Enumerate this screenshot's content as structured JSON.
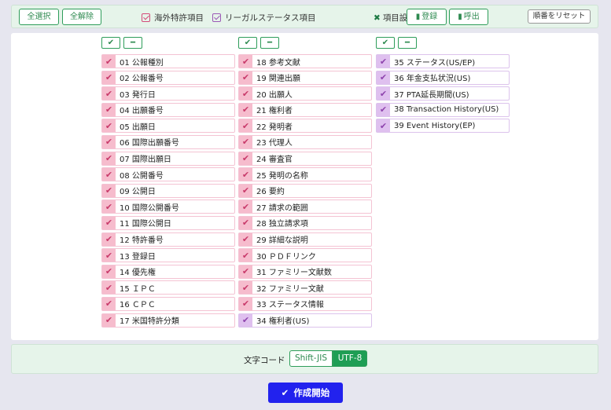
{
  "toolbar": {
    "select_all": "全選択",
    "deselect_all": "全解除",
    "foreign_patent": "海外特許項目",
    "legal_status": "リーガルステータス項目",
    "item_setting": "項目設定",
    "register": "登録",
    "recall": "呼出",
    "reset_order": "順番をリセット"
  },
  "columns": [
    {
      "items": [
        {
          "label": "01 公報種別",
          "type": "pink"
        },
        {
          "label": "02 公報番号",
          "type": "pink"
        },
        {
          "label": "03 発行日",
          "type": "pink"
        },
        {
          "label": "04 出願番号",
          "type": "pink"
        },
        {
          "label": "05 出願日",
          "type": "pink"
        },
        {
          "label": "06 国際出願番号",
          "type": "pink"
        },
        {
          "label": "07 国際出願日",
          "type": "pink"
        },
        {
          "label": "08 公開番号",
          "type": "pink"
        },
        {
          "label": "09 公開日",
          "type": "pink"
        },
        {
          "label": "10 国際公開番号",
          "type": "pink"
        },
        {
          "label": "11 国際公開日",
          "type": "pink"
        },
        {
          "label": "12 特許番号",
          "type": "pink"
        },
        {
          "label": "13 登録日",
          "type": "pink"
        },
        {
          "label": "14 優先権",
          "type": "pink"
        },
        {
          "label": "15 ＩＰＣ",
          "type": "pink"
        },
        {
          "label": "16 ＣＰＣ",
          "type": "pink"
        },
        {
          "label": "17 米国特許分類",
          "type": "pink"
        }
      ]
    },
    {
      "items": [
        {
          "label": "18 参考文献",
          "type": "pink"
        },
        {
          "label": "19 関連出願",
          "type": "pink"
        },
        {
          "label": "20 出願人",
          "type": "pink"
        },
        {
          "label": "21 権利者",
          "type": "pink"
        },
        {
          "label": "22 発明者",
          "type": "pink"
        },
        {
          "label": "23 代理人",
          "type": "pink"
        },
        {
          "label": "24 審査官",
          "type": "pink"
        },
        {
          "label": "25 発明の名称",
          "type": "pink"
        },
        {
          "label": "26 要約",
          "type": "pink"
        },
        {
          "label": "27 請求の範囲",
          "type": "pink"
        },
        {
          "label": "28 独立請求項",
          "type": "pink"
        },
        {
          "label": "29 詳細な説明",
          "type": "pink"
        },
        {
          "label": "30 ＰＤＦリンク",
          "type": "pink"
        },
        {
          "label": "31 ファミリー文献数",
          "type": "pink"
        },
        {
          "label": "32 ファミリー文献",
          "type": "pink"
        },
        {
          "label": "33 ステータス情報",
          "type": "pink"
        },
        {
          "label": "34 権利者(US)",
          "type": "purple"
        }
      ]
    },
    {
      "items": [
        {
          "label": "35 ステータス(US/EP)",
          "type": "purple"
        },
        {
          "label": "36 年金支払状況(US)",
          "type": "purple"
        },
        {
          "label": "37 PTA延長期間(US)",
          "type": "purple"
        },
        {
          "label": "38 Transaction History(US)",
          "type": "purple"
        },
        {
          "label": "39 Event History(EP)",
          "type": "purple"
        }
      ]
    }
  ],
  "encoding": {
    "label": "文字コード",
    "options": [
      "Shift-JIS",
      "UTF-8"
    ],
    "selected": "UTF-8"
  },
  "start_button": "作成開始"
}
